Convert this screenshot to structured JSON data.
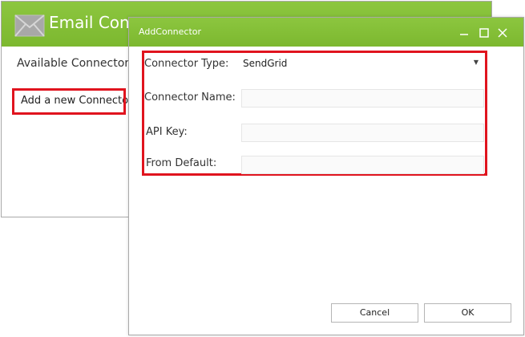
{
  "background_window": {
    "title": "Email Conn",
    "logo_icon": "envelope-icon",
    "available_label": "Available Connectors",
    "add_button_label": "Add a new Connector"
  },
  "dialog": {
    "title": "AddConnector",
    "controls": [
      "minimize-icon",
      "maximize-icon",
      "close-icon"
    ],
    "fields": {
      "connector_type": {
        "label": "Connector Type:",
        "value": "SendGrid"
      },
      "connector_name": {
        "label": "Connector Name:",
        "value": ""
      },
      "api_key": {
        "label": "API Key:",
        "value": ""
      },
      "from_default": {
        "label": "From Default:",
        "value": ""
      }
    },
    "buttons": {
      "cancel": "Cancel",
      "ok": "OK"
    }
  },
  "colors": {
    "titlebar_green": "#8cc63f",
    "highlight_red": "#e0141e"
  }
}
